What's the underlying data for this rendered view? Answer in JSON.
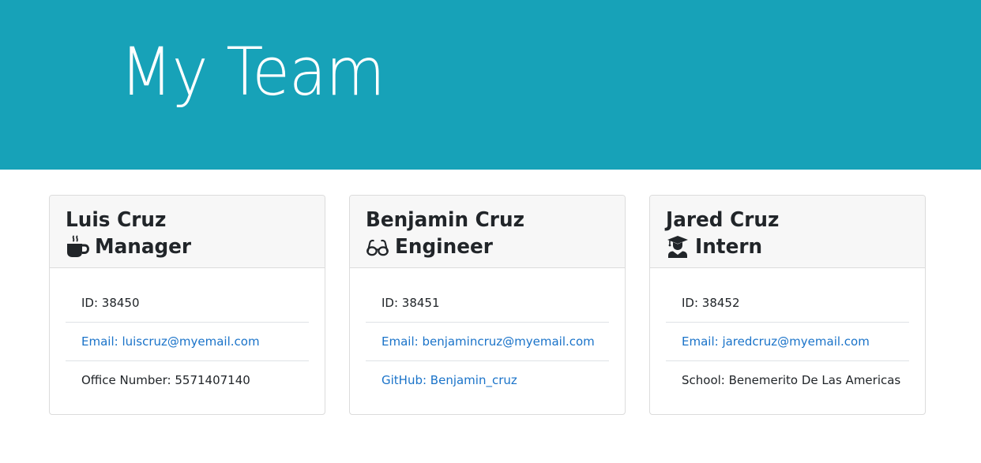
{
  "header": {
    "title": "My Team"
  },
  "theme": {
    "banner_color": "#17a2b8",
    "link_color": "#1a73c9"
  },
  "cards": [
    {
      "name": "Luis Cruz",
      "role": "Manager",
      "role_icon": "coffee-icon",
      "id_text": "ID: 38450",
      "email_text": "Email: luiscruz@myemail.com",
      "extra_text": "Office Number: 5571407140"
    },
    {
      "name": "Benjamin Cruz",
      "role": "Engineer",
      "role_icon": "glasses-icon",
      "id_text": "ID: 38451",
      "email_text": "Email: benjamincruz@myemail.com",
      "extra_text": "GitHub: Benjamin_cruz"
    },
    {
      "name": "Jared Cruz",
      "role": "Intern",
      "role_icon": "user-graduate-icon",
      "id_text": "ID: 38452",
      "email_text": "Email: jaredcruz@myemail.com",
      "extra_text": "School: Benemerito De Las Americas"
    }
  ]
}
